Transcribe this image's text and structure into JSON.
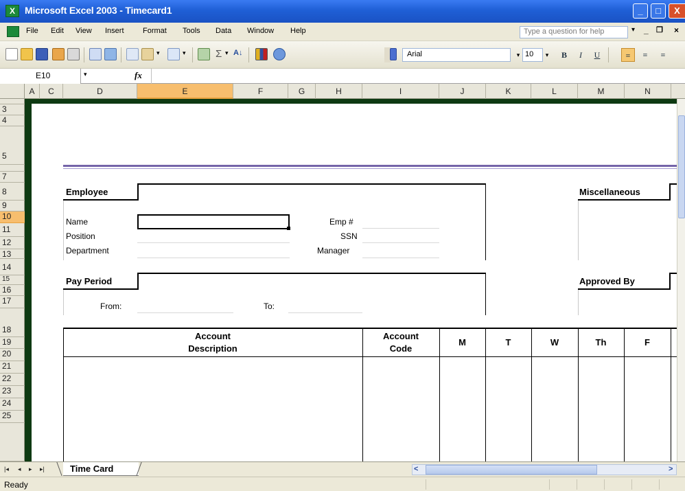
{
  "window": {
    "title": "Microsoft Excel 2003 - Timecard1",
    "min_glyph": "_",
    "max_glyph": "□",
    "close_glyph": "X"
  },
  "menu": {
    "items": [
      "File",
      "Edit",
      "View",
      "Insert",
      "Format",
      "Tools",
      "Data",
      "Window",
      "Help"
    ],
    "help_placeholder": "Type a question for help",
    "help_dropdown": "▾",
    "doc_min": "_",
    "doc_restore": "❐",
    "doc_close": "×"
  },
  "toolbar": {
    "font_name": "Arial",
    "font_size": "10",
    "bold_label": "B",
    "italic_label": "I",
    "underline_label": "U",
    "icons": [
      "new-icon",
      "open-icon",
      "save-icon",
      "permission-icon",
      "print-icon",
      "print-preview-icon",
      "research-icon",
      "copy-icon",
      "paste-icon",
      "undo-icon",
      "hyperlink-icon",
      "autosum-icon",
      "sort-ascending-icon",
      "chart-wizard-icon",
      "help-icon"
    ],
    "autosum_glyph": "Σ",
    "sort_glyph": "A↓",
    "dropdown_glyph": "▾"
  },
  "formula_bar": {
    "cell_ref": "E10",
    "dropdown": "▾",
    "fx_label": "fx",
    "value": ""
  },
  "grid": {
    "columns": [
      "A",
      "C",
      "D",
      "E",
      "F",
      "G",
      "H",
      "I",
      "J",
      "K",
      "L",
      "M",
      "N"
    ],
    "selected_column": "E",
    "rows": [
      "3",
      "4",
      "5",
      "7",
      "8",
      "9",
      "10",
      "11",
      "12",
      "13",
      "14",
      "15",
      "16",
      "17",
      "18",
      "19",
      "20",
      "21",
      "22",
      "23",
      "24",
      "25"
    ],
    "selected_row": "10"
  },
  "form": {
    "employee_header": "Employee",
    "misc_header": "Miscellaneous",
    "name_label": "Name",
    "position_label": "Position",
    "department_label": "Department",
    "emp_num_label": "Emp #",
    "ssn_label": "SSN",
    "manager_label": "Manager",
    "pay_period_header": "Pay Period",
    "approved_by_header": "Approved By",
    "from_label": "From:",
    "to_label": "To:",
    "table_headers": {
      "account_description_1": "Account",
      "account_description_2": "Description",
      "account_code_1": "Account",
      "account_code_2": "Code",
      "mon": "M",
      "tue": "T",
      "wed": "W",
      "thu": "Th",
      "fri": "F"
    }
  },
  "tabs": {
    "first": "|◂",
    "prev": "◂",
    "next": "▸",
    "last": "▸|",
    "sheet": "Time Card",
    "scroll_left": "<",
    "scroll_right": ">"
  },
  "status": {
    "text": "Ready"
  }
}
